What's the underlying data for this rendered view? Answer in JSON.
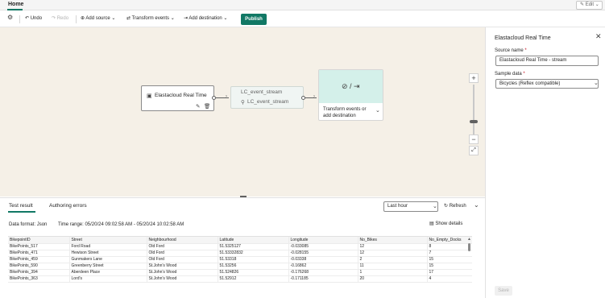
{
  "tabs": {
    "home": "Home"
  },
  "edit_button": {
    "label": "Edit"
  },
  "toolbar": {
    "undo": "Undo",
    "redo": "Redo",
    "add_source": "Add source",
    "transform_events": "Transform events",
    "add_destination": "Add destination",
    "publish": "Publish"
  },
  "canvas": {
    "source_node_title": "Elastacloud Real Time",
    "stream_node_title": "LC_event_stream",
    "stream_node_sub": "LC_event_stream",
    "dest_node_text": "Transform events or add destination",
    "zoom_in": "+",
    "zoom_out": "−"
  },
  "panel": {
    "title": "Elastacloud Real Time",
    "source_name_label": "Source name",
    "source_name_value": "Elastacloud Real Time - stream",
    "sample_data_label": "Sample data",
    "sample_data_value": "Bicycles (Reflex compatible)",
    "save": "Save",
    "required_mark": "*"
  },
  "bottom": {
    "tab_test": "Test result",
    "tab_errors": "Authoring errors",
    "time_select": "Last hour",
    "refresh": "Refresh",
    "data_format_label": "Data format:",
    "data_format_value": "Json",
    "time_range_label": "Time range:",
    "time_range_value": "05/20/24 09:02:58 AM - 05/20/24 10:02:58 AM",
    "show_details": "Show details"
  },
  "grid": {
    "columns": [
      "BikepointID",
      "Street",
      "Neighbourhood",
      "Latitude",
      "Longitude",
      "No_Bikes",
      "No_Empty_Docks"
    ],
    "rows": [
      [
        "BikePoints_517",
        "Ford Road",
        "Old Ford",
        "51.5325127",
        "-0.033085",
        "12",
        "8"
      ],
      [
        "BikePoints_471",
        "Hewison Street",
        "Old Ford",
        "51.53332832",
        "-0.028155",
        "12",
        "7"
      ],
      [
        "BikePoints_459",
        "Gunmakers Lane",
        "Old Ford",
        "51.53318",
        "-0.03338",
        "2",
        "15"
      ],
      [
        "BikePoints_590",
        "Greenberry Street",
        "St.John's Wood",
        "51.53256",
        "-0.16862",
        "11",
        "15"
      ],
      [
        "BikePoints_394",
        "Aberdeen Place",
        "St.John's Wood",
        "51.524826",
        "-0.176268",
        "1",
        "17"
      ],
      [
        "BikePoints_363",
        "Lord's",
        "St.John's Wood",
        "51.52912",
        "-0.171185",
        "20",
        "4"
      ]
    ]
  },
  "colors": {
    "accent": "#117865",
    "canvas_bg": "#f5f0e7",
    "dest_bg": "#d4f0ea"
  }
}
